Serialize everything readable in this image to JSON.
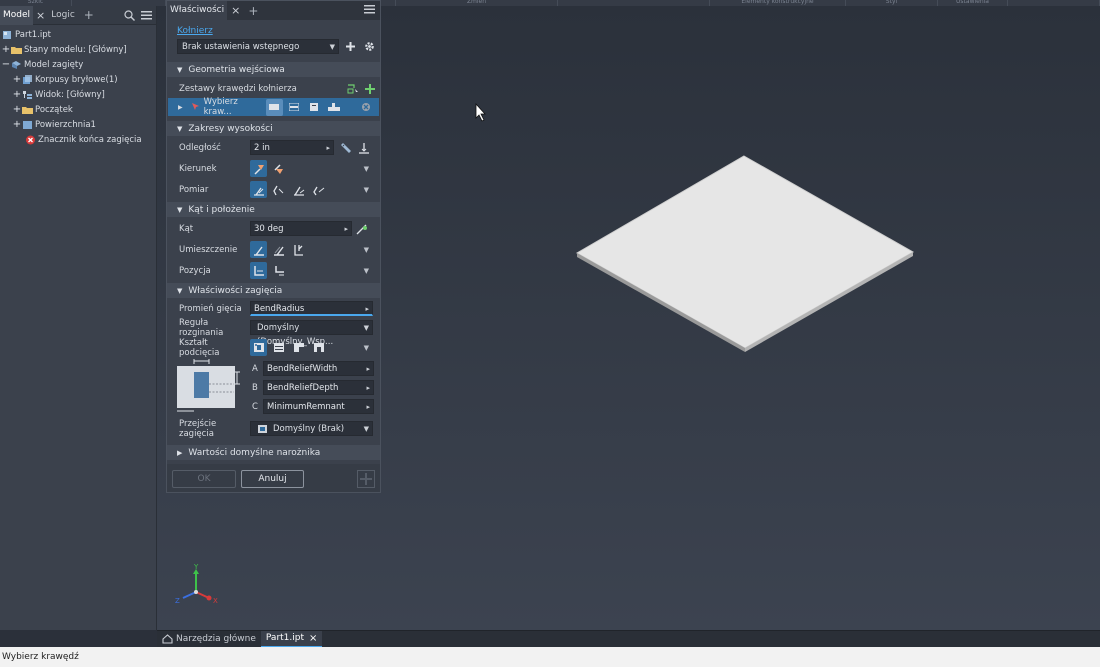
{
  "ribbon": {
    "items": [
      "Szkic",
      "",
      "",
      "",
      "Zmień",
      "",
      "Elementy konstrukcyjne",
      "Styl",
      "Ustawienia",
      ""
    ]
  },
  "browser": {
    "tabs": [
      "Model",
      "Logic"
    ],
    "tree": [
      {
        "label": "Part1.ipt",
        "expander": "",
        "icon": "part-icon"
      },
      {
        "label": "Stany modelu: [Główny]",
        "expander": "+",
        "icon": "folder-icon"
      },
      {
        "label": "Model zagięty",
        "expander": "−",
        "icon": "sheet-metal-icon"
      },
      {
        "label": "Korpusy bryłowe(1)",
        "expander": "+",
        "icon": "solid-bodies-icon"
      },
      {
        "label": "Widok: [Główny]",
        "expander": "+",
        "icon": "view-icon"
      },
      {
        "label": "Początek",
        "expander": "+",
        "icon": "folder-icon"
      },
      {
        "label": "Powierzchnia1",
        "expander": "+",
        "icon": "face-icon"
      },
      {
        "label": "Znacznik końca zagięcia",
        "expander": "",
        "icon": "error-icon"
      }
    ]
  },
  "props": {
    "tab_label": "Właściwości",
    "feature_link": "Kołnierz",
    "preset": "Brak ustawienia wstępnego",
    "sections": {
      "geometry": "Geometria wejściowa",
      "height": "Zakresy wysokości",
      "angle": "Kąt i położenie",
      "bend": "Właściwości zagięcia",
      "corner": "Wartości domyślne narożnika"
    },
    "edge_sets_label": "Zestawy krawędzi kołnierza",
    "select_edge": "Wybierz kraw...",
    "distance_label": "Odległość",
    "distance_value": "2 in",
    "direction_label": "Kierunek",
    "measure_label": "Pomiar",
    "angle_label": "Kąt",
    "angle_value": "30 deg",
    "placement_label": "Umieszczenie",
    "position_label": "Pozycja",
    "bend_radius_label": "Promień gięcia",
    "bend_radius_value": "BendRadius",
    "unfold_rule_label": "Reguła rozginania",
    "unfold_rule_value": "Domyślny (Domyślny_Wsp...",
    "relief_shape_label": "Kształt podcięcia",
    "relief_a_letter": "A",
    "relief_b_letter": "B",
    "relief_c_letter": "C",
    "relief_a_value": "BendReliefWidth",
    "relief_b_value": "BendReliefDepth",
    "relief_c_value": "MinimumRemnant",
    "bend_transition_label": "Przejście zagięcia",
    "bend_transition_value": "Domyślny (Brak)",
    "ok_label": "OK",
    "cancel_label": "Anuluj"
  },
  "viewport": {
    "axis_x": "X",
    "axis_y": "Y",
    "axis_z": "Z"
  },
  "doc_tabs": {
    "home": "Narzędzia główne",
    "part": "Part1.ipt"
  },
  "status": "Wybierz krawędź",
  "colors": {
    "accent": "#4aa8ee",
    "selected": "#2f6a9b",
    "plate": "#e6e6e6",
    "error": "#d93a3a"
  }
}
